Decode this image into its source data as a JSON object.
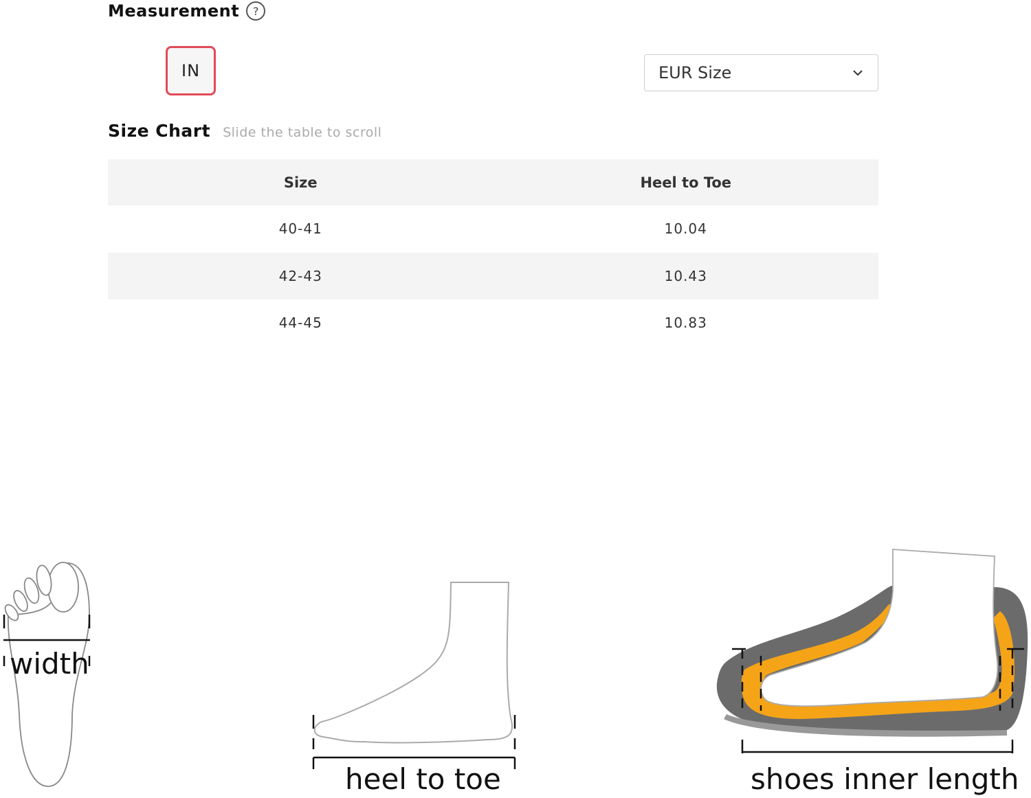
{
  "measurement": {
    "title": "Measurement",
    "help_glyph": "?",
    "unit_button_label": "IN"
  },
  "size_select": {
    "value": "EUR Size"
  },
  "size_chart": {
    "title": "Size Chart",
    "hint": "Slide the table to scroll",
    "columns": [
      "Size",
      "Heel to Toe"
    ],
    "rows": [
      [
        "40-41",
        "10.04"
      ],
      [
        "42-43",
        "10.43"
      ],
      [
        "44-45",
        "10.83"
      ]
    ]
  },
  "illustrations": {
    "width_label": "width",
    "heel_to_toe_label": "heel to toe",
    "inner_length_label": "shoes inner length"
  },
  "colors": {
    "unit_button_border": "#e24a57",
    "insole_orange": "#f5a418",
    "sole_gray": "#6b6b6b"
  }
}
